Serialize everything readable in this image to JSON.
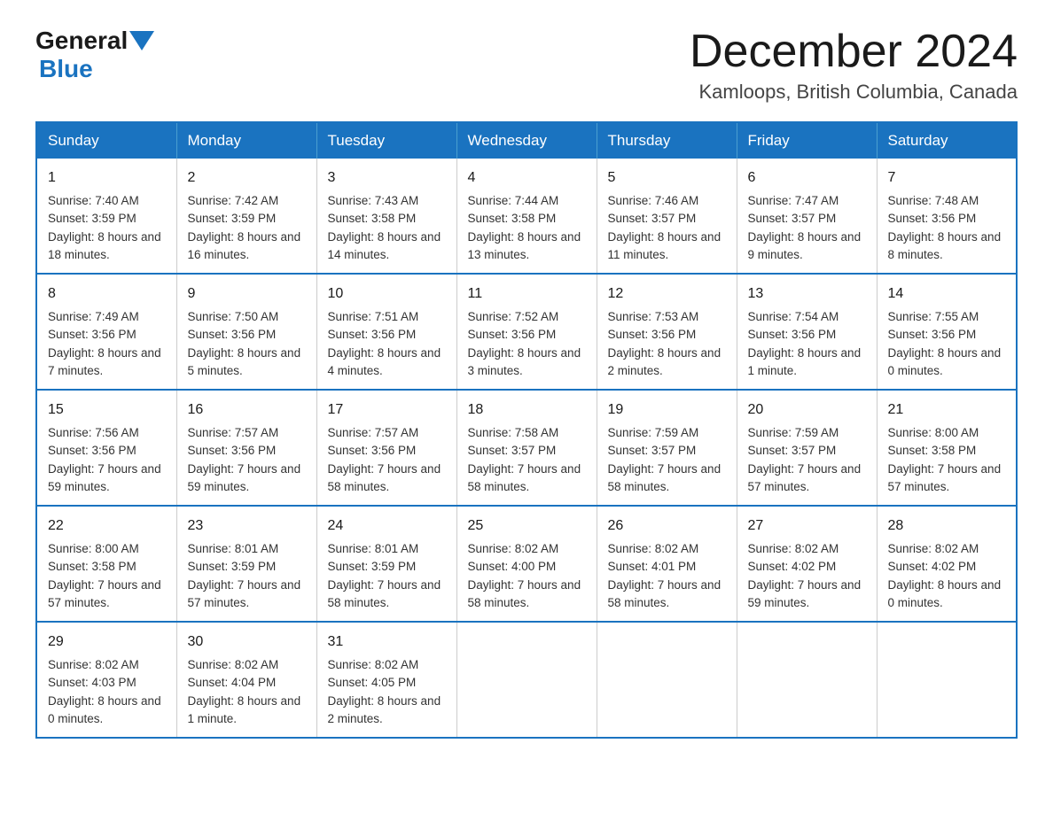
{
  "header": {
    "logo": {
      "part1": "General",
      "part2": "Blue"
    },
    "title": "December 2024",
    "location": "Kamloops, British Columbia, Canada"
  },
  "weekdays": [
    "Sunday",
    "Monday",
    "Tuesday",
    "Wednesday",
    "Thursday",
    "Friday",
    "Saturday"
  ],
  "weeks": [
    [
      {
        "day": "1",
        "sunrise": "7:40 AM",
        "sunset": "3:59 PM",
        "daylight": "8 hours and 18 minutes."
      },
      {
        "day": "2",
        "sunrise": "7:42 AM",
        "sunset": "3:59 PM",
        "daylight": "8 hours and 16 minutes."
      },
      {
        "day": "3",
        "sunrise": "7:43 AM",
        "sunset": "3:58 PM",
        "daylight": "8 hours and 14 minutes."
      },
      {
        "day": "4",
        "sunrise": "7:44 AM",
        "sunset": "3:58 PM",
        "daylight": "8 hours and 13 minutes."
      },
      {
        "day": "5",
        "sunrise": "7:46 AM",
        "sunset": "3:57 PM",
        "daylight": "8 hours and 11 minutes."
      },
      {
        "day": "6",
        "sunrise": "7:47 AM",
        "sunset": "3:57 PM",
        "daylight": "8 hours and 9 minutes."
      },
      {
        "day": "7",
        "sunrise": "7:48 AM",
        "sunset": "3:56 PM",
        "daylight": "8 hours and 8 minutes."
      }
    ],
    [
      {
        "day": "8",
        "sunrise": "7:49 AM",
        "sunset": "3:56 PM",
        "daylight": "8 hours and 7 minutes."
      },
      {
        "day": "9",
        "sunrise": "7:50 AM",
        "sunset": "3:56 PM",
        "daylight": "8 hours and 5 minutes."
      },
      {
        "day": "10",
        "sunrise": "7:51 AM",
        "sunset": "3:56 PM",
        "daylight": "8 hours and 4 minutes."
      },
      {
        "day": "11",
        "sunrise": "7:52 AM",
        "sunset": "3:56 PM",
        "daylight": "8 hours and 3 minutes."
      },
      {
        "day": "12",
        "sunrise": "7:53 AM",
        "sunset": "3:56 PM",
        "daylight": "8 hours and 2 minutes."
      },
      {
        "day": "13",
        "sunrise": "7:54 AM",
        "sunset": "3:56 PM",
        "daylight": "8 hours and 1 minute."
      },
      {
        "day": "14",
        "sunrise": "7:55 AM",
        "sunset": "3:56 PM",
        "daylight": "8 hours and 0 minutes."
      }
    ],
    [
      {
        "day": "15",
        "sunrise": "7:56 AM",
        "sunset": "3:56 PM",
        "daylight": "7 hours and 59 minutes."
      },
      {
        "day": "16",
        "sunrise": "7:57 AM",
        "sunset": "3:56 PM",
        "daylight": "7 hours and 59 minutes."
      },
      {
        "day": "17",
        "sunrise": "7:57 AM",
        "sunset": "3:56 PM",
        "daylight": "7 hours and 58 minutes."
      },
      {
        "day": "18",
        "sunrise": "7:58 AM",
        "sunset": "3:57 PM",
        "daylight": "7 hours and 58 minutes."
      },
      {
        "day": "19",
        "sunrise": "7:59 AM",
        "sunset": "3:57 PM",
        "daylight": "7 hours and 58 minutes."
      },
      {
        "day": "20",
        "sunrise": "7:59 AM",
        "sunset": "3:57 PM",
        "daylight": "7 hours and 57 minutes."
      },
      {
        "day": "21",
        "sunrise": "8:00 AM",
        "sunset": "3:58 PM",
        "daylight": "7 hours and 57 minutes."
      }
    ],
    [
      {
        "day": "22",
        "sunrise": "8:00 AM",
        "sunset": "3:58 PM",
        "daylight": "7 hours and 57 minutes."
      },
      {
        "day": "23",
        "sunrise": "8:01 AM",
        "sunset": "3:59 PM",
        "daylight": "7 hours and 57 minutes."
      },
      {
        "day": "24",
        "sunrise": "8:01 AM",
        "sunset": "3:59 PM",
        "daylight": "7 hours and 58 minutes."
      },
      {
        "day": "25",
        "sunrise": "8:02 AM",
        "sunset": "4:00 PM",
        "daylight": "7 hours and 58 minutes."
      },
      {
        "day": "26",
        "sunrise": "8:02 AM",
        "sunset": "4:01 PM",
        "daylight": "7 hours and 58 minutes."
      },
      {
        "day": "27",
        "sunrise": "8:02 AM",
        "sunset": "4:02 PM",
        "daylight": "7 hours and 59 minutes."
      },
      {
        "day": "28",
        "sunrise": "8:02 AM",
        "sunset": "4:02 PM",
        "daylight": "8 hours and 0 minutes."
      }
    ],
    [
      {
        "day": "29",
        "sunrise": "8:02 AM",
        "sunset": "4:03 PM",
        "daylight": "8 hours and 0 minutes."
      },
      {
        "day": "30",
        "sunrise": "8:02 AM",
        "sunset": "4:04 PM",
        "daylight": "8 hours and 1 minute."
      },
      {
        "day": "31",
        "sunrise": "8:02 AM",
        "sunset": "4:05 PM",
        "daylight": "8 hours and 2 minutes."
      },
      null,
      null,
      null,
      null
    ]
  ]
}
